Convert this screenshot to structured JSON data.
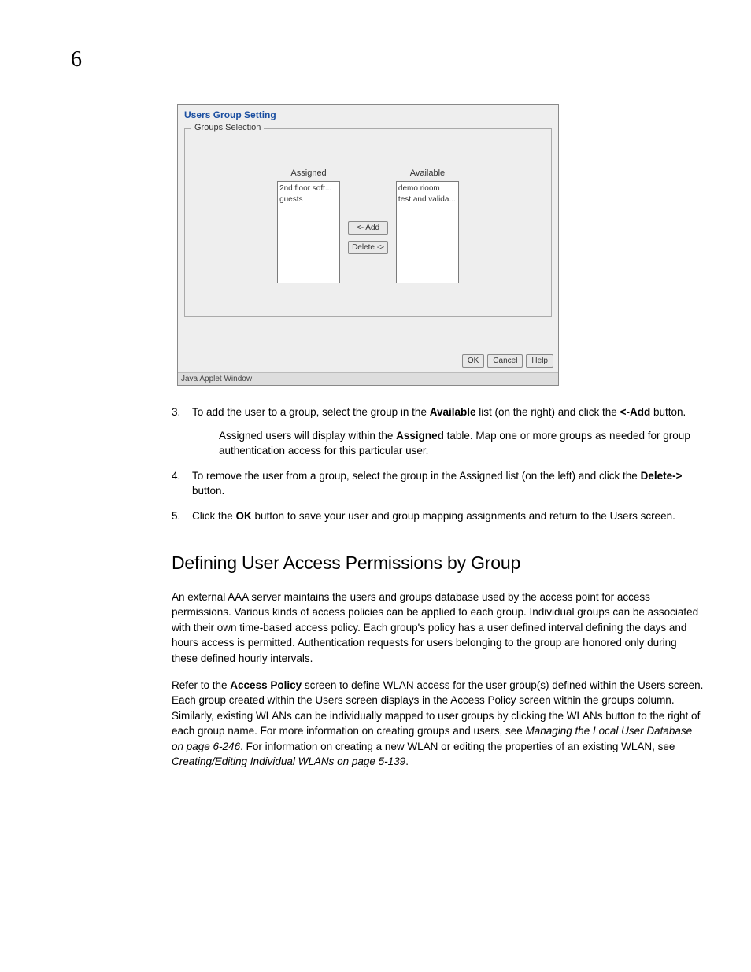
{
  "page_number": "6",
  "applet": {
    "title": "Users Group Setting",
    "fieldset_legend": "Groups Selection",
    "assigned_label": "Assigned",
    "available_label": "Available",
    "assigned_items": [
      "2nd floor soft...",
      "guests"
    ],
    "available_items": [
      "demo rioom",
      "test and valida..."
    ],
    "add_btn": "<- Add",
    "delete_btn": "Delete ->",
    "ok_btn": "OK",
    "cancel_btn": "Cancel",
    "help_btn": "Help",
    "status": "Java Applet Window"
  },
  "steps": {
    "s3": {
      "num": "3.",
      "t1": "To add the user to a group, select the group in the ",
      "b1": "Available",
      "t2": " list (on the right) and click the ",
      "b2": "<-Add",
      "t3": " button.",
      "sub_t1": "Assigned users will display within the ",
      "sub_b1": "Assigned",
      "sub_t2": " table. Map one or more groups as needed for group authentication access for this particular user."
    },
    "s4": {
      "num": "4.",
      "t1": "To remove the user from a group, select the group in the Assigned list (on the left) and click the ",
      "b1": "Delete->",
      "t2": " button."
    },
    "s5": {
      "num": "5.",
      "t1": "Click the ",
      "b1": "OK",
      "t2": " button to save your user and group mapping assignments and return to the Users screen."
    }
  },
  "section_heading": "Defining User Access Permissions by Group",
  "para1": "An external AAA server maintains the users and groups database used by the access point for access permissions. Various kinds of access policies can be applied to each group. Individual groups can be associated with their own time-based access policy. Each group's policy has a user defined interval defining the days and hours access is permitted. Authentication requests for users belonging to the group are honored only during these defined hourly intervals.",
  "para2": {
    "t1": "Refer to the ",
    "b1": "Access Policy",
    "t2": " screen to define WLAN access for the user group(s) defined within the Users screen. Each group created within the Users screen displays in the Access Policy screen within the groups column. Similarly, existing WLANs can be individually mapped to user groups by clicking the WLANs button to the right of each group name. For more information on creating groups and users, see ",
    "i1": "Managing the Local User Database on page 6-246",
    "t3": ". For information on creating a new WLAN or editing the properties of an existing WLAN, see ",
    "i2": "Creating/Editing Individual WLANs on page 5-139",
    "t4": "."
  }
}
